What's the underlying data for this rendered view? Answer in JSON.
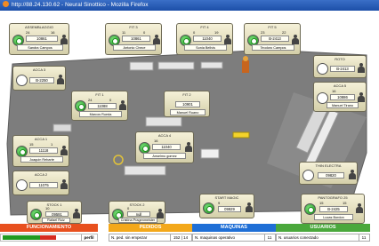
{
  "window": {
    "title": "http://88.24.130.62 - Neural Sinottico - Mozilla Firefox"
  },
  "panels": [
    {
      "id": "assemblaggio",
      "title": "ASSEMBLAGGIO",
      "left_num": "24",
      "right_num": "16",
      "value": "10861",
      "name": "Sandra Campos",
      "indicator": "green"
    },
    {
      "id": "fit3",
      "title": "FIT 3",
      "left_num": "11",
      "right_num": "0",
      "value": "10861",
      "name": "Antonio Chece",
      "indicator": "green"
    },
    {
      "id": "fit4",
      "title": "FIT 4",
      "left_num": "0",
      "right_num": "19",
      "value": "11040",
      "name": "Sonia Bellvis",
      "indicator": "green"
    },
    {
      "id": "fit5",
      "title": "FIT 5",
      "left_num": "23",
      "right_num": "22",
      "value": "B-2413",
      "name": "Teodoro Campos",
      "indicator": "green"
    },
    {
      "id": "acca3",
      "title": "ACCA 3",
      "left_num": "",
      "right_num": "",
      "value": "B-2250",
      "name": "",
      "indicator": "off"
    },
    {
      "id": "roto",
      "title": "ROTO",
      "left_num": "",
      "right_num": "",
      "value": "B-2413",
      "name": "",
      "indicator": "off"
    },
    {
      "id": "acca5",
      "title": "ACCA 5",
      "left_num": "16",
      "right_num": "",
      "value": "10886",
      "name": "Manuel Tirano",
      "indicator": "off"
    },
    {
      "id": "fit1",
      "title": "FIT 1",
      "left_num": "24",
      "right_num": "0",
      "value": "11088",
      "name": "Marcos Rueda",
      "indicator": "green"
    },
    {
      "id": "fit2",
      "title": "FIT 2",
      "left_num": "",
      "right_num": "",
      "value": "10901",
      "name": "Manuel Ruano",
      "indicator": "off"
    },
    {
      "id": "acca1",
      "title": "ACCA 1",
      "left_num": "15",
      "right_num": "1",
      "value": "11118",
      "name": "Joaquin Rebarte",
      "indicator": "green"
    },
    {
      "id": "acca4",
      "title": "ACCA 4",
      "left_num": "16",
      "right_num": "",
      "value": "11040",
      "name": "Anselmo gomez",
      "indicator": "green"
    },
    {
      "id": "acca2",
      "title": "ACCA 2",
      "left_num": "",
      "right_num": "",
      "value": "11075",
      "name": "",
      "indicator": "off"
    },
    {
      "id": "thinelectra",
      "title": "THIN ELECTRA",
      "left_num": "",
      "right_num": "",
      "value": "09820",
      "name": "",
      "indicator": "off"
    },
    {
      "id": "stock1",
      "title": "STOCK 1",
      "left_num": "10",
      "right_num": "",
      "value": "09591",
      "name": "Rafael Ruiz",
      "indicator": "green"
    },
    {
      "id": "stock2",
      "title": "STOCK 2",
      "left_num": "0",
      "right_num": "",
      "value": "null",
      "name": "Cristina Pragenmeister",
      "indicator": "green"
    },
    {
      "id": "startmagic",
      "title": "START MAGIC",
      "left_num": "9",
      "right_num": "",
      "value": "09929",
      "name": "",
      "indicator": "green"
    },
    {
      "id": "pantografo",
      "title": "PANTOGRAFO 25",
      "left_num": "15",
      "right_num": "15",
      "value": "B-2425",
      "name": "Lucas Bordon",
      "indicator": "green"
    }
  ],
  "footer": [
    {
      "id": "funcionamiento",
      "header": "FUNCIONAMIENTO",
      "color": "#e8501e",
      "row_label": "",
      "row_value": "perfil"
    },
    {
      "id": "pedidos",
      "header": "PEDIDOS",
      "color": "#f3a81a",
      "row_label": "N. ped. sin empezar",
      "row_value": "152 | 14"
    },
    {
      "id": "maquinas",
      "header": "MAQUINAS",
      "color": "#1f6fd6",
      "row_label": "N. maquinas operativo",
      "row_value": "11"
    },
    {
      "id": "usuarios",
      "header": "USUARIOS",
      "color": "#4aa83c",
      "row_label": "N. usuarios conectado",
      "row_value": "11"
    }
  ]
}
